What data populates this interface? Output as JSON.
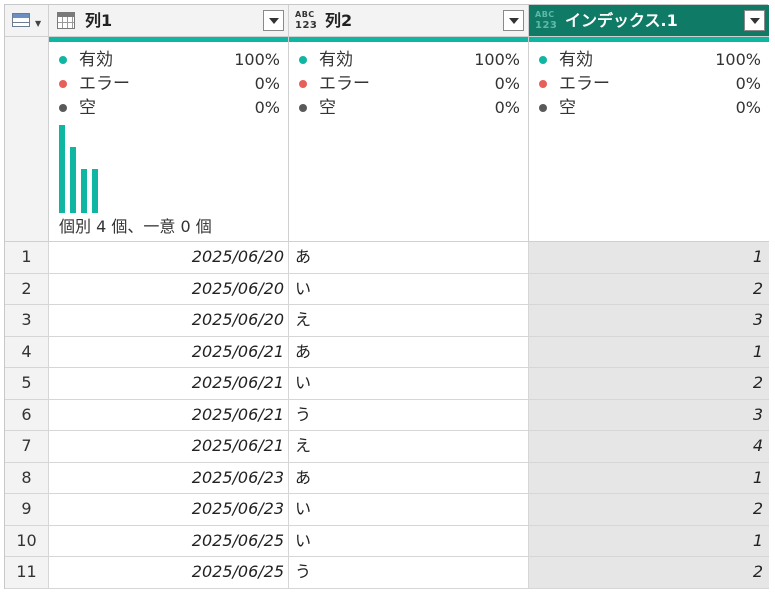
{
  "columns": [
    {
      "title": "列1",
      "type_icon": "calendar-icon"
    },
    {
      "title": "列2",
      "type_icon": "abc-123-icon",
      "type_top": "ABC",
      "type_bottom": "123"
    },
    {
      "title": "インデックス.1",
      "type_icon": "abc-123-icon",
      "type_top": "ABC",
      "type_bottom": "123",
      "selected": true
    }
  ],
  "quality_labels": {
    "valid": "有効",
    "error": "エラー",
    "empty": "空"
  },
  "profiles": [
    {
      "valid": "100%",
      "error": "0%",
      "empty": "0%",
      "distinct_text": "個別 4 個、一意 0 個",
      "histogram": [
        4,
        3,
        2,
        2
      ]
    },
    {
      "valid": "100%",
      "error": "0%",
      "empty": "0%"
    },
    {
      "valid": "100%",
      "error": "0%",
      "empty": "0%"
    }
  ],
  "rows": [
    {
      "index": "1",
      "date": "2025/06/20",
      "text": "あ",
      "num": "1"
    },
    {
      "index": "2",
      "date": "2025/06/20",
      "text": "い",
      "num": "2"
    },
    {
      "index": "3",
      "date": "2025/06/20",
      "text": "え",
      "num": "3"
    },
    {
      "index": "4",
      "date": "2025/06/21",
      "text": "あ",
      "num": "1"
    },
    {
      "index": "5",
      "date": "2025/06/21",
      "text": "い",
      "num": "2"
    },
    {
      "index": "6",
      "date": "2025/06/21",
      "text": "う",
      "num": "3"
    },
    {
      "index": "7",
      "date": "2025/06/21",
      "text": "え",
      "num": "4"
    },
    {
      "index": "8",
      "date": "2025/06/23",
      "text": "あ",
      "num": "1"
    },
    {
      "index": "9",
      "date": "2025/06/23",
      "text": "い",
      "num": "2"
    },
    {
      "index": "10",
      "date": "2025/06/25",
      "text": "い",
      "num": "1"
    },
    {
      "index": "11",
      "date": "2025/06/25",
      "text": "う",
      "num": "2"
    }
  ],
  "colors": {
    "accent": "#0fb7a2",
    "selected_header": "#0f7b67",
    "error": "#e8605a",
    "empty": "#5a5a5a"
  }
}
